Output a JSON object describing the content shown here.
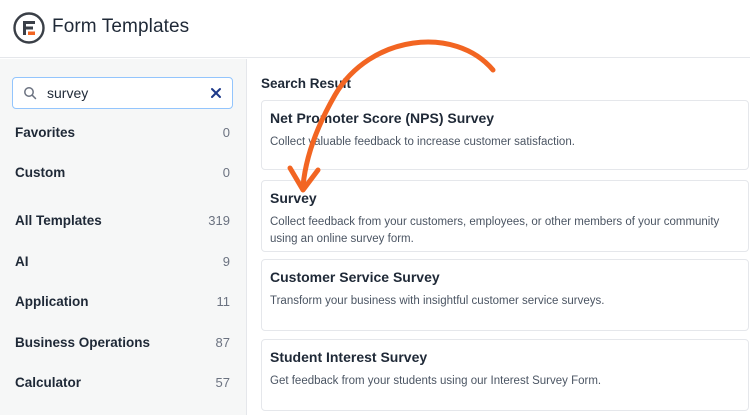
{
  "app": {
    "title": "Form Templates"
  },
  "search": {
    "value": "survey",
    "placeholder": ""
  },
  "sidebar": {
    "items": [
      {
        "label": "Favorites",
        "count": "0"
      },
      {
        "label": "Custom",
        "count": "0"
      },
      {
        "label": "All Templates",
        "count": "319"
      },
      {
        "label": "AI",
        "count": "9"
      },
      {
        "label": "Application",
        "count": "11"
      },
      {
        "label": "Business Operations",
        "count": "87"
      },
      {
        "label": "Calculator",
        "count": "57"
      }
    ]
  },
  "main": {
    "section_title": "Search Result",
    "results": [
      {
        "title": "Net Promoter Score (NPS) Survey",
        "desc": "Collect valuable feedback to increase customer satisfaction."
      },
      {
        "title": "Survey",
        "desc": "Collect feedback from your customers, employees, or other members of your community using an online survey form."
      },
      {
        "title": "Customer Service Survey",
        "desc": "Transform your business with insightful customer service surveys."
      },
      {
        "title": "Student Interest Survey",
        "desc": "Get feedback from your students using our Interest Survey Form."
      }
    ]
  },
  "colors": {
    "accent_orange": "#f26522",
    "logo_dark": "#3a3f47"
  },
  "icons": [
    "logo-icon",
    "search-icon",
    "close-icon",
    "arrow-annotation"
  ]
}
